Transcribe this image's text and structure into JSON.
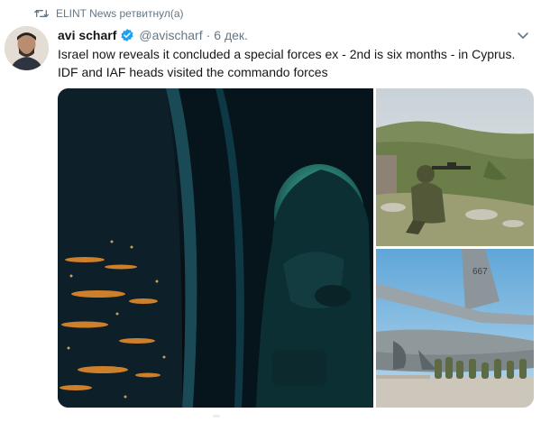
{
  "retweet": {
    "icon": "retweet-icon",
    "text": "ELINT News ретвитнул(а)"
  },
  "tweet": {
    "author_name": "avi scharf",
    "verified_icon": "verified-badge-icon",
    "handle": "@avischarf",
    "separator": "·",
    "time": "6 дек.",
    "text_line1": "Israel now reveals it concluded a special forces ex - 2nd is six months - in Cyprus.",
    "text_line2": "IDF and IAF heads visited the commando forces",
    "menu_icon": "chevron-down-icon"
  },
  "media": {
    "photos": [
      {
        "subject": "night-helicopter-window-photo"
      },
      {
        "subject": "sniper-on-hillside-photo"
      },
      {
        "subject": "transport-plane-troops-photo"
      }
    ],
    "tail_number": "667"
  },
  "colors": {
    "text": "#14171a",
    "secondary": "#657786",
    "verified": "#1da1f2"
  }
}
